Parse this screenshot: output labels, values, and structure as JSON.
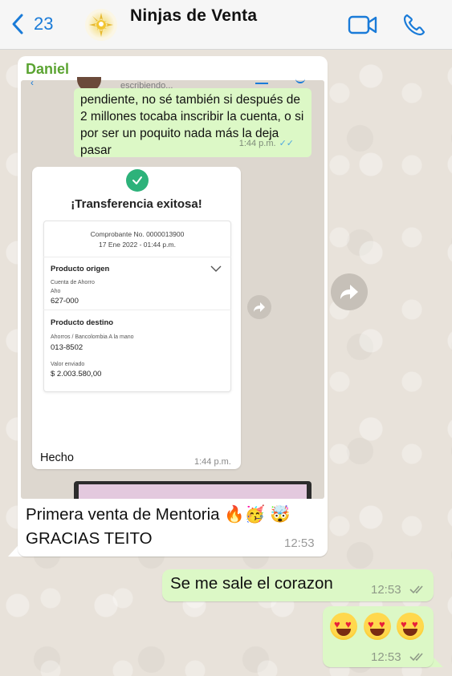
{
  "header": {
    "back_count": "23",
    "title": "Ninjas de Venta"
  },
  "message_in": {
    "sender": "Daniel",
    "screenshot": {
      "typing": "escribiendo...",
      "green_text": "pendiente, no sé también si después de 2 millones tocaba inscribir la cuenta, o si por ser un poquito nada más la deja pasar",
      "green_time": "1:44 p.m.",
      "card": {
        "title": "¡Transferencia exitosa!",
        "comprobante": "Comprobante No. 0000013900",
        "date": "17 Ene 2022 - 01:44 p.m.",
        "origin_label": "Producto origen",
        "origin_type": "Cuenta de Ahorro",
        "origin_sub": "Aho",
        "origin_account": "627-000",
        "dest_label": "Producto destino",
        "dest_type": "Ahorros / Bancolombia A la mano",
        "dest_account": "013-8502",
        "amount_label": "Valor enviado",
        "amount": "$ 2.003.580,00"
      },
      "done_label": "Hecho",
      "done_time": "1:44 p.m."
    },
    "caption": "Primera venta de Mentoria 🔥🥳 🤯 GRACIAS TEITO",
    "time": "12:53"
  },
  "message_out_1": {
    "text": "Se me sale el corazon",
    "time": "12:53"
  },
  "message_out_2": {
    "emoji_icons": [
      "heart-eyes-emoji",
      "heart-eyes-emoji",
      "heart-eyes-emoji"
    ],
    "time": "12:53"
  },
  "colors": {
    "accent": "#1a7bd8",
    "sender_name": "#5ba432",
    "outgoing_bubble": "#dcf8c6",
    "success_check": "#2db27a"
  }
}
